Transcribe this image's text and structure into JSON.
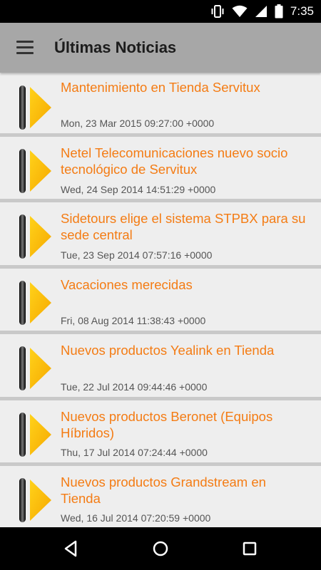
{
  "status_bar": {
    "time": "7:35",
    "icons": [
      "vibrate-icon",
      "wifi-icon",
      "signal-icon",
      "battery-icon"
    ]
  },
  "app_bar": {
    "title": "Últimas Noticias",
    "menu_icon": "hamburger-menu-icon"
  },
  "colors": {
    "accent": "#f47c14",
    "app_bar_bg": "#a7a7a7",
    "item_bg": "#eeeeee",
    "separator": "#c9c9c9"
  },
  "news": [
    {
      "title": "Mantenimiento en Tienda Servitux",
      "date": "Mon, 23 Mar 2015 09:27:00 +0000"
    },
    {
      "title": "Netel Telecomunicaciones nuevo socio tecnológico de Servitux",
      "date": "Wed, 24 Sep 2014 14:51:29 +0000"
    },
    {
      "title": "Sidetours elige el sistema STPBX para su sede central",
      "date": "Tue, 23 Sep 2014 07:57:16 +0000"
    },
    {
      "title": "Vacaciones merecidas",
      "date": "Fri, 08 Aug 2014 11:38:43 +0000"
    },
    {
      "title": "Nuevos productos Yealink en Tienda",
      "date": "Tue, 22 Jul 2014 09:44:46 +0000"
    },
    {
      "title": "Nuevos productos Beronet (Equipos Híbridos)",
      "date": "Thu, 17 Jul 2014 07:24:44 +0000"
    },
    {
      "title": "Nuevos productos Grandstream en Tienda",
      "date": "Wed, 16 Jul 2014 07:20:59 +0000"
    }
  ],
  "nav_bar": {
    "buttons": [
      "back-icon",
      "home-icon",
      "recents-icon"
    ]
  }
}
